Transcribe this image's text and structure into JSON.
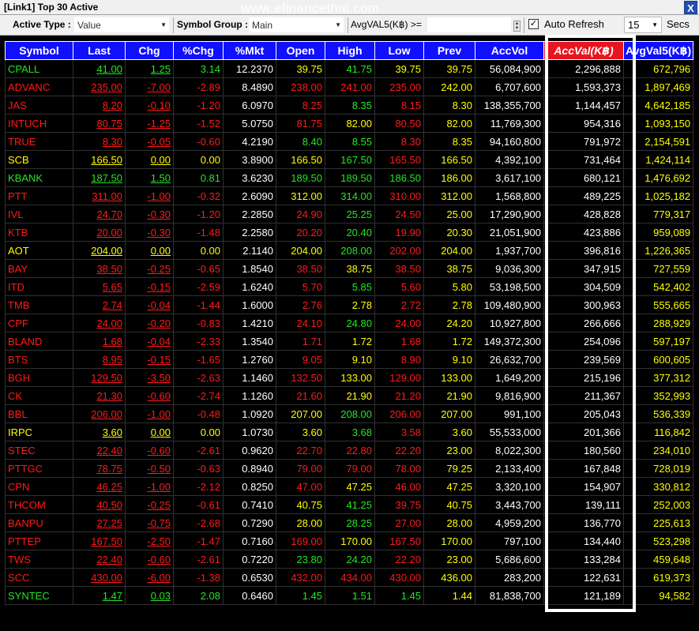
{
  "window": {
    "title": "[Link1] Top 30 Active",
    "watermark": "www.efinancethai.com",
    "close_label": "X"
  },
  "toolbar": {
    "active_type_label": "Active Type :",
    "active_type_value": "Value",
    "symbol_group_label": "Symbol Group :",
    "symbol_group_value": "Main",
    "avgval_filter_label": "AvgVAL5(K฿) >=",
    "avgval_filter_value": "",
    "auto_refresh_label": "Auto Refresh",
    "auto_refresh_checked": true,
    "refresh_interval": "15",
    "secs_label": "Secs"
  },
  "colors": {
    "header_bg": "#1010ff",
    "sorted_header_bg": "#e8141e",
    "up": "#22e622",
    "down": "#ff1a1a",
    "unchanged": "#ffff00"
  },
  "columns": [
    "Symbol",
    "Last",
    "Chg",
    "%Chg",
    "%Mkt",
    "Open",
    "High",
    "Low",
    "Prev",
    "AccVol",
    "AccVal(K฿)",
    "AvgVal5(K฿)"
  ],
  "sorted_column": "AccVal(K฿)",
  "rows": [
    {
      "symbol": "CPALL",
      "last": "41.00",
      "chg": "1.25",
      "pchg": "3.14",
      "pmkt": "12.2370",
      "open": "39.75",
      "high": "41.75",
      "low": "39.75",
      "prev": "39.75",
      "accvol": "56,084,900",
      "accval": "2,296,888",
      "avgval5": "672,796",
      "dir": "up",
      "c_open": "eq",
      "c_high": "up",
      "c_low": "eq"
    },
    {
      "symbol": "ADVANC",
      "last": "235.00",
      "chg": "-7.00",
      "pchg": "-2.89",
      "pmkt": "8.4890",
      "open": "238.00",
      "high": "241.00",
      "low": "235.00",
      "prev": "242.00",
      "accvol": "6,707,600",
      "accval": "1,593,373",
      "avgval5": "1,897,469",
      "dir": "dn",
      "c_open": "dn",
      "c_high": "dn",
      "c_low": "dn"
    },
    {
      "symbol": "JAS",
      "last": "8.20",
      "chg": "-0.10",
      "pchg": "-1.20",
      "pmkt": "6.0970",
      "open": "8.25",
      "high": "8.35",
      "low": "8.15",
      "prev": "8.30",
      "accvol": "138,355,700",
      "accval": "1,144,457",
      "avgval5": "4,642,185",
      "dir": "dn",
      "c_open": "dn",
      "c_high": "up",
      "c_low": "dn"
    },
    {
      "symbol": "INTUCH",
      "last": "80.75",
      "chg": "-1.25",
      "pchg": "-1.52",
      "pmkt": "5.0750",
      "open": "81.75",
      "high": "82.00",
      "low": "80.50",
      "prev": "82.00",
      "accvol": "11,769,300",
      "accval": "954,316",
      "avgval5": "1,093,150",
      "dir": "dn",
      "c_open": "dn",
      "c_high": "eq",
      "c_low": "dn"
    },
    {
      "symbol": "TRUE",
      "last": "8.30",
      "chg": "-0.05",
      "pchg": "-0.60",
      "pmkt": "4.2190",
      "open": "8.40",
      "high": "8.55",
      "low": "8.30",
      "prev": "8.35",
      "accvol": "94,160,800",
      "accval": "791,972",
      "avgval5": "2,154,591",
      "dir": "dn",
      "c_open": "up",
      "c_high": "up",
      "c_low": "dn"
    },
    {
      "symbol": "SCB",
      "last": "166.50",
      "chg": "0.00",
      "pchg": "0.00",
      "pmkt": "3.8900",
      "open": "166.50",
      "high": "167.50",
      "low": "165.50",
      "prev": "166.50",
      "accvol": "4,392,100",
      "accval": "731,464",
      "avgval5": "1,424,114",
      "dir": "eq",
      "c_open": "eq",
      "c_high": "up",
      "c_low": "dn"
    },
    {
      "symbol": "KBANK",
      "last": "187.50",
      "chg": "1.50",
      "pchg": "0.81",
      "pmkt": "3.6230",
      "open": "189.50",
      "high": "189.50",
      "low": "186.50",
      "prev": "186.00",
      "accvol": "3,617,100",
      "accval": "680,121",
      "avgval5": "1,476,692",
      "dir": "up",
      "c_open": "up",
      "c_high": "up",
      "c_low": "up"
    },
    {
      "symbol": "PTT",
      "last": "311.00",
      "chg": "-1.00",
      "pchg": "-0.32",
      "pmkt": "2.6090",
      "open": "312.00",
      "high": "314.00",
      "low": "310.00",
      "prev": "312.00",
      "accvol": "1,568,800",
      "accval": "489,225",
      "avgval5": "1,025,182",
      "dir": "dn",
      "c_open": "eq",
      "c_high": "up",
      "c_low": "dn"
    },
    {
      "symbol": "IVL",
      "last": "24.70",
      "chg": "-0.30",
      "pchg": "-1.20",
      "pmkt": "2.2850",
      "open": "24.90",
      "high": "25.25",
      "low": "24.50",
      "prev": "25.00",
      "accvol": "17,290,900",
      "accval": "428,828",
      "avgval5": "779,317",
      "dir": "dn",
      "c_open": "dn",
      "c_high": "up",
      "c_low": "dn"
    },
    {
      "symbol": "KTB",
      "last": "20.00",
      "chg": "-0.30",
      "pchg": "-1.48",
      "pmkt": "2.2580",
      "open": "20.20",
      "high": "20.40",
      "low": "19.90",
      "prev": "20.30",
      "accvol": "21,051,900",
      "accval": "423,886",
      "avgval5": "959,089",
      "dir": "dn",
      "c_open": "dn",
      "c_high": "up",
      "c_low": "dn"
    },
    {
      "symbol": "AOT",
      "last": "204.00",
      "chg": "0.00",
      "pchg": "0.00",
      "pmkt": "2.1140",
      "open": "204.00",
      "high": "208.00",
      "low": "202.00",
      "prev": "204.00",
      "accvol": "1,937,700",
      "accval": "396,816",
      "avgval5": "1,226,365",
      "dir": "eq",
      "c_open": "eq",
      "c_high": "up",
      "c_low": "dn"
    },
    {
      "symbol": "BAY",
      "last": "38.50",
      "chg": "-0.25",
      "pchg": "-0.65",
      "pmkt": "1.8540",
      "open": "38.50",
      "high": "38.75",
      "low": "38.50",
      "prev": "38.75",
      "accvol": "9,036,300",
      "accval": "347,915",
      "avgval5": "727,559",
      "dir": "dn",
      "c_open": "dn",
      "c_high": "eq",
      "c_low": "dn"
    },
    {
      "symbol": "ITD",
      "last": "5.65",
      "chg": "-0.15",
      "pchg": "-2.59",
      "pmkt": "1.6240",
      "open": "5.70",
      "high": "5.85",
      "low": "5.60",
      "prev": "5.80",
      "accvol": "53,198,500",
      "accval": "304,509",
      "avgval5": "542,402",
      "dir": "dn",
      "c_open": "dn",
      "c_high": "up",
      "c_low": "dn"
    },
    {
      "symbol": "TMB",
      "last": "2.74",
      "chg": "-0.04",
      "pchg": "-1.44",
      "pmkt": "1.6000",
      "open": "2.76",
      "high": "2.78",
      "low": "2.72",
      "prev": "2.78",
      "accvol": "109,480,900",
      "accval": "300,963",
      "avgval5": "555,665",
      "dir": "dn",
      "c_open": "dn",
      "c_high": "eq",
      "c_low": "dn"
    },
    {
      "symbol": "CPF",
      "last": "24.00",
      "chg": "-0.20",
      "pchg": "-0.83",
      "pmkt": "1.4210",
      "open": "24.10",
      "high": "24.80",
      "low": "24.00",
      "prev": "24.20",
      "accvol": "10,927,800",
      "accval": "266,666",
      "avgval5": "288,929",
      "dir": "dn",
      "c_open": "dn",
      "c_high": "up",
      "c_low": "dn"
    },
    {
      "symbol": "BLAND",
      "last": "1.68",
      "chg": "-0.04",
      "pchg": "-2.33",
      "pmkt": "1.3540",
      "open": "1.71",
      "high": "1.72",
      "low": "1.68",
      "prev": "1.72",
      "accvol": "149,372,300",
      "accval": "254,096",
      "avgval5": "597,197",
      "dir": "dn",
      "c_open": "dn",
      "c_high": "eq",
      "c_low": "dn"
    },
    {
      "symbol": "BTS",
      "last": "8.95",
      "chg": "-0.15",
      "pchg": "-1.65",
      "pmkt": "1.2760",
      "open": "9.05",
      "high": "9.10",
      "low": "8.90",
      "prev": "9.10",
      "accvol": "26,632,700",
      "accval": "239,569",
      "avgval5": "600,605",
      "dir": "dn",
      "c_open": "dn",
      "c_high": "eq",
      "c_low": "dn"
    },
    {
      "symbol": "BGH",
      "last": "129.50",
      "chg": "-3.50",
      "pchg": "-2.63",
      "pmkt": "1.1460",
      "open": "132.50",
      "high": "133.00",
      "low": "129.00",
      "prev": "133.00",
      "accvol": "1,649,200",
      "accval": "215,196",
      "avgval5": "377,312",
      "dir": "dn",
      "c_open": "dn",
      "c_high": "eq",
      "c_low": "dn"
    },
    {
      "symbol": "CK",
      "last": "21.30",
      "chg": "-0.60",
      "pchg": "-2.74",
      "pmkt": "1.1260",
      "open": "21.60",
      "high": "21.90",
      "low": "21.20",
      "prev": "21.90",
      "accvol": "9,816,900",
      "accval": "211,367",
      "avgval5": "352,993",
      "dir": "dn",
      "c_open": "dn",
      "c_high": "eq",
      "c_low": "dn"
    },
    {
      "symbol": "BBL",
      "last": "206.00",
      "chg": "-1.00",
      "pchg": "-0.48",
      "pmkt": "1.0920",
      "open": "207.00",
      "high": "208.00",
      "low": "206.00",
      "prev": "207.00",
      "accvol": "991,100",
      "accval": "205,043",
      "avgval5": "536,339",
      "dir": "dn",
      "c_open": "eq",
      "c_high": "up",
      "c_low": "dn"
    },
    {
      "symbol": "IRPC",
      "last": "3.60",
      "chg": "0.00",
      "pchg": "0.00",
      "pmkt": "1.0730",
      "open": "3.60",
      "high": "3.68",
      "low": "3.58",
      "prev": "3.60",
      "accvol": "55,533,000",
      "accval": "201,366",
      "avgval5": "116,842",
      "dir": "eq",
      "c_open": "eq",
      "c_high": "up",
      "c_low": "dn"
    },
    {
      "symbol": "STEC",
      "last": "22.40",
      "chg": "-0.60",
      "pchg": "-2.61",
      "pmkt": "0.9620",
      "open": "22.70",
      "high": "22.80",
      "low": "22.20",
      "prev": "23.00",
      "accvol": "8,022,300",
      "accval": "180,560",
      "avgval5": "234,010",
      "dir": "dn",
      "c_open": "dn",
      "c_high": "dn",
      "c_low": "dn"
    },
    {
      "symbol": "PTTGC",
      "last": "78.75",
      "chg": "-0.50",
      "pchg": "-0.63",
      "pmkt": "0.8940",
      "open": "79.00",
      "high": "79.00",
      "low": "78.00",
      "prev": "79.25",
      "accvol": "2,133,400",
      "accval": "167,848",
      "avgval5": "728,019",
      "dir": "dn",
      "c_open": "dn",
      "c_high": "dn",
      "c_low": "dn"
    },
    {
      "symbol": "CPN",
      "last": "46.25",
      "chg": "-1.00",
      "pchg": "-2.12",
      "pmkt": "0.8250",
      "open": "47.00",
      "high": "47.25",
      "low": "46.00",
      "prev": "47.25",
      "accvol": "3,320,100",
      "accval": "154,907",
      "avgval5": "330,812",
      "dir": "dn",
      "c_open": "dn",
      "c_high": "eq",
      "c_low": "dn"
    },
    {
      "symbol": "THCOM",
      "last": "40.50",
      "chg": "-0.25",
      "pchg": "-0.61",
      "pmkt": "0.7410",
      "open": "40.75",
      "high": "41.25",
      "low": "39.75",
      "prev": "40.75",
      "accvol": "3,443,700",
      "accval": "139,111",
      "avgval5": "252,003",
      "dir": "dn",
      "c_open": "eq",
      "c_high": "up",
      "c_low": "dn"
    },
    {
      "symbol": "BANPU",
      "last": "27.25",
      "chg": "-0.75",
      "pchg": "-2.68",
      "pmkt": "0.7290",
      "open": "28.00",
      "high": "28.25",
      "low": "27.00",
      "prev": "28.00",
      "accvol": "4,959,200",
      "accval": "136,770",
      "avgval5": "225,613",
      "dir": "dn",
      "c_open": "eq",
      "c_high": "up",
      "c_low": "dn"
    },
    {
      "symbol": "PTTEP",
      "last": "167.50",
      "chg": "-2.50",
      "pchg": "-1.47",
      "pmkt": "0.7160",
      "open": "169.00",
      "high": "170.00",
      "low": "167.50",
      "prev": "170.00",
      "accvol": "797,100",
      "accval": "134,440",
      "avgval5": "523,298",
      "dir": "dn",
      "c_open": "dn",
      "c_high": "eq",
      "c_low": "dn"
    },
    {
      "symbol": "TWS",
      "last": "22.40",
      "chg": "-0.60",
      "pchg": "-2.61",
      "pmkt": "0.7220",
      "open": "23.80",
      "high": "24.20",
      "low": "22.20",
      "prev": "23.00",
      "accvol": "5,686,600",
      "accval": "133,284",
      "avgval5": "459,648",
      "dir": "dn",
      "c_open": "up",
      "c_high": "up",
      "c_low": "dn"
    },
    {
      "symbol": "SCC",
      "last": "430.00",
      "chg": "-6.00",
      "pchg": "-1.38",
      "pmkt": "0.6530",
      "open": "432.00",
      "high": "434.00",
      "low": "430.00",
      "prev": "436.00",
      "accvol": "283,200",
      "accval": "122,631",
      "avgval5": "619,373",
      "dir": "dn",
      "c_open": "dn",
      "c_high": "dn",
      "c_low": "dn"
    },
    {
      "symbol": "SYNTEC",
      "last": "1.47",
      "chg": "0.03",
      "pchg": "2.08",
      "pmkt": "0.6460",
      "open": "1.45",
      "high": "1.51",
      "low": "1.45",
      "prev": "1.44",
      "accvol": "81,838,700",
      "accval": "121,189",
      "avgval5": "94,582",
      "dir": "up",
      "c_open": "up",
      "c_high": "up",
      "c_low": "up"
    }
  ]
}
